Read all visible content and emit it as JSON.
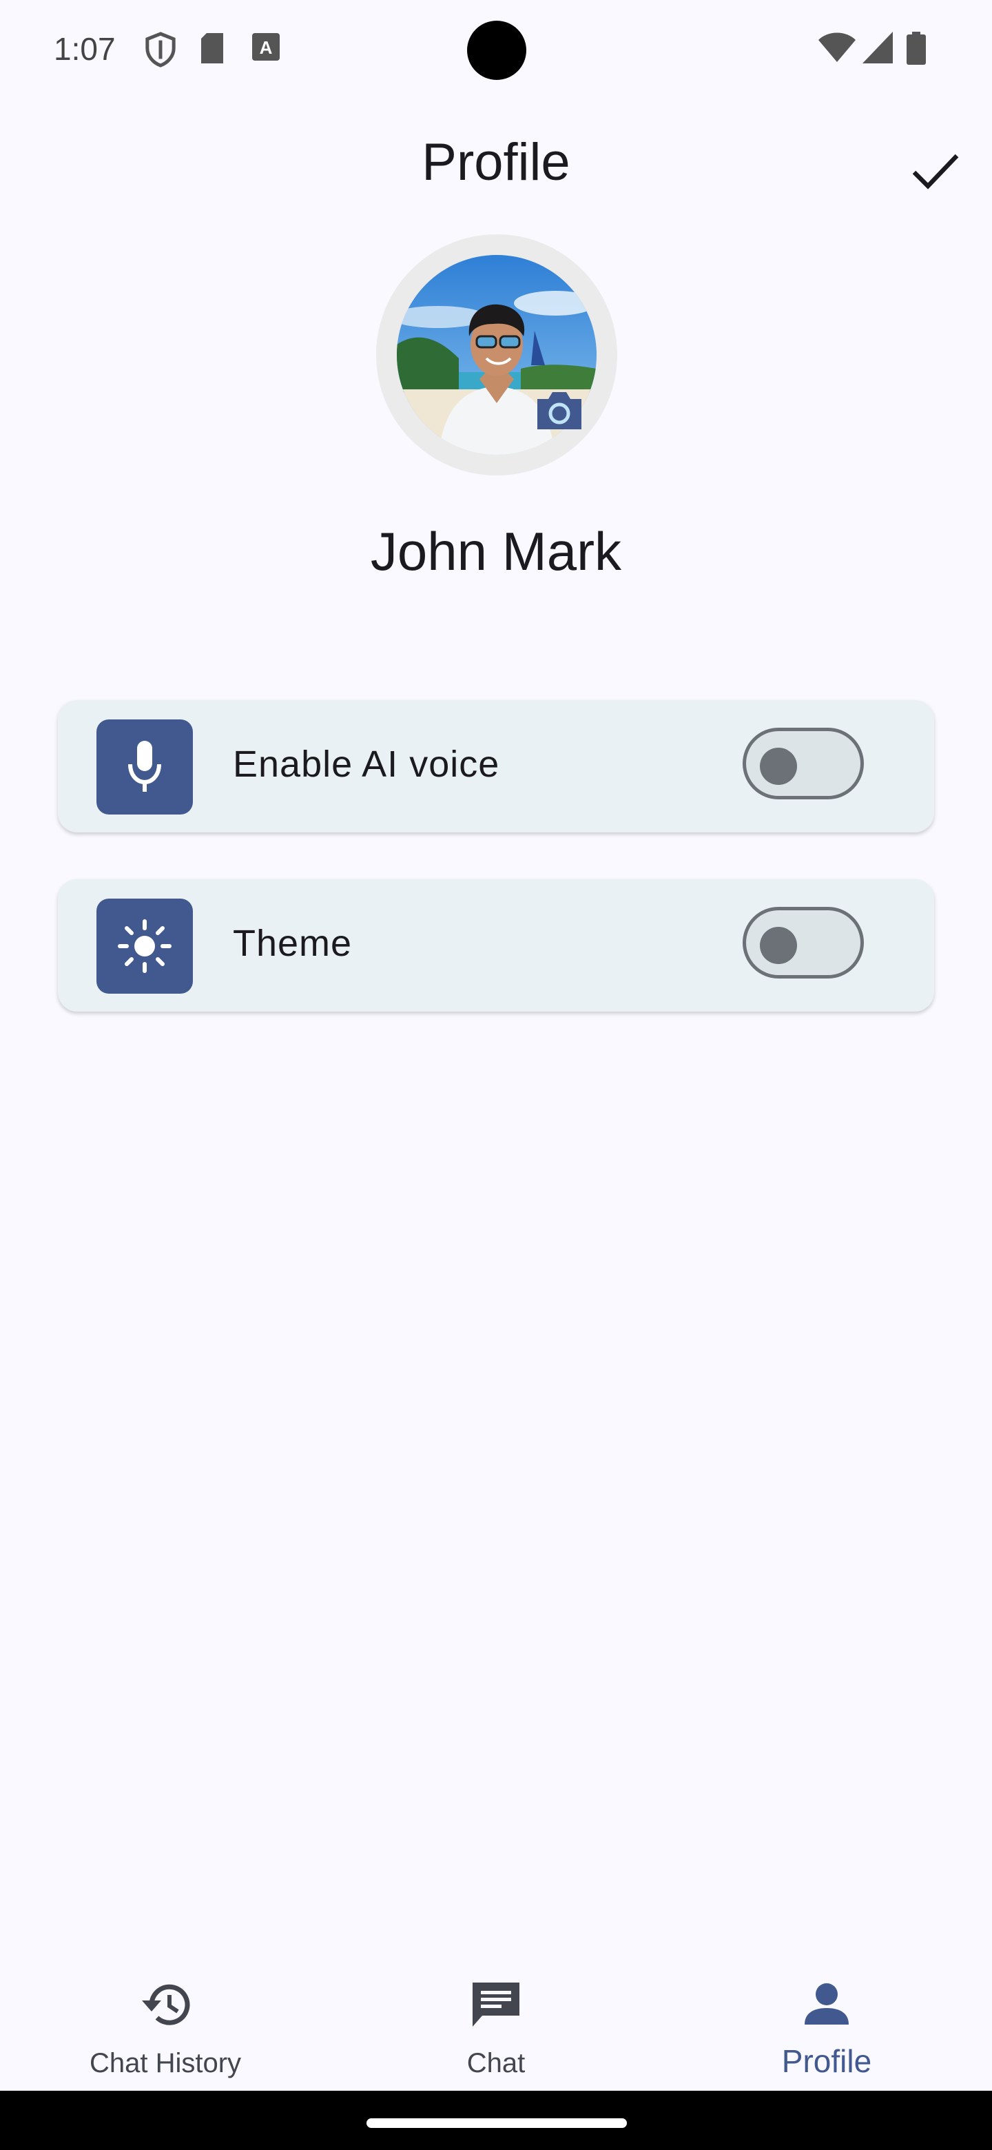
{
  "status_bar": {
    "time": "1:07",
    "icons": [
      "shield-icon",
      "sd-card-icon",
      "keyboard-a-icon",
      "wifi-icon",
      "signal-icon",
      "battery-icon"
    ]
  },
  "header": {
    "title": "Profile",
    "confirm_icon": "check-icon"
  },
  "profile": {
    "name": "John Mark",
    "camera_icon": "camera-icon"
  },
  "settings": [
    {
      "label": "Enable AI voice",
      "icon": "mic-icon",
      "enabled": false
    },
    {
      "label": "Theme",
      "icon": "sun-icon",
      "enabled": false
    }
  ],
  "bottom_nav": {
    "items": [
      {
        "label": "Chat History",
        "icon": "history-icon",
        "active": false
      },
      {
        "label": "Chat",
        "icon": "chat-icon",
        "active": false
      },
      {
        "label": "Profile",
        "icon": "person-icon",
        "active": true
      }
    ]
  },
  "colors": {
    "accent": "#41598f",
    "background": "#f9f9ff",
    "card": "#eaf1f4",
    "switch_outline": "#6b7176"
  }
}
